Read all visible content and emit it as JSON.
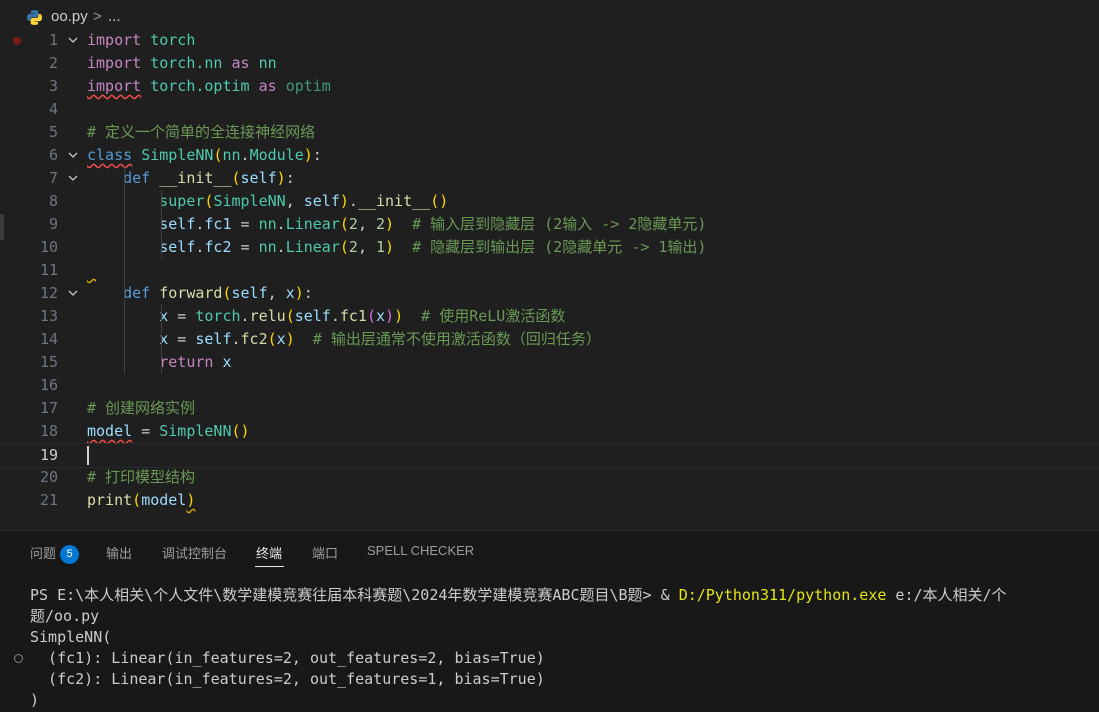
{
  "breadcrumb": {
    "file": "oo.py",
    "separator": ">",
    "more": "..."
  },
  "editor": {
    "lines": [
      {
        "n": "1",
        "tokens": [
          [
            "import",
            "kw"
          ],
          [
            " ",
            "pl"
          ],
          [
            "torch",
            "cls"
          ]
        ]
      },
      {
        "n": "2",
        "tokens": [
          [
            "import",
            "kw"
          ],
          [
            " ",
            "pl"
          ],
          [
            "torch.nn",
            "cls"
          ],
          [
            " ",
            "pl"
          ],
          [
            "as",
            "kw"
          ],
          [
            " ",
            "pl"
          ],
          [
            "nn",
            "cls"
          ]
        ]
      },
      {
        "n": "3",
        "tokens": [
          [
            "import",
            "kw sq-red"
          ],
          [
            " ",
            "pl"
          ],
          [
            "torch.optim",
            "cls"
          ],
          [
            " ",
            "pl"
          ],
          [
            "as",
            "kw"
          ],
          [
            " ",
            "pl"
          ],
          [
            "optim",
            "dim"
          ]
        ]
      },
      {
        "n": "4",
        "tokens": []
      },
      {
        "n": "5",
        "tokens": [
          [
            "# 定义一个简单的全连接神经网络",
            "cm"
          ]
        ]
      },
      {
        "n": "6",
        "tokens": [
          [
            "class",
            "kw2 sq-red"
          ],
          [
            " ",
            "pl"
          ],
          [
            "SimpleNN",
            "cls"
          ],
          [
            "(",
            "b1"
          ],
          [
            "nn",
            "cls"
          ],
          [
            ".",
            "pl"
          ],
          [
            "Module",
            "cls"
          ],
          [
            ")",
            "b1"
          ],
          [
            ":",
            "pl"
          ]
        ]
      },
      {
        "n": "7",
        "tokens": [
          [
            "    ",
            "pl"
          ],
          [
            "def",
            "kw2"
          ],
          [
            " ",
            "pl"
          ],
          [
            "__init__",
            "fn"
          ],
          [
            "(",
            "b1"
          ],
          [
            "self",
            "var"
          ],
          [
            ")",
            "b1"
          ],
          [
            ":",
            "pl"
          ]
        ]
      },
      {
        "n": "8",
        "tokens": [
          [
            "        ",
            "pl"
          ],
          [
            "super",
            "cls"
          ],
          [
            "(",
            "b1"
          ],
          [
            "SimpleNN",
            "cls"
          ],
          [
            ", ",
            "pl"
          ],
          [
            "self",
            "var"
          ],
          [
            ")",
            "b1"
          ],
          [
            ".",
            "pl"
          ],
          [
            "__init__",
            "fn"
          ],
          [
            "()",
            "b1"
          ]
        ]
      },
      {
        "n": "9",
        "tokens": [
          [
            "        ",
            "pl"
          ],
          [
            "self",
            "var"
          ],
          [
            ".",
            "pl"
          ],
          [
            "fc1",
            "var"
          ],
          [
            " = ",
            "pl"
          ],
          [
            "nn",
            "cls"
          ],
          [
            ".",
            "pl"
          ],
          [
            "Linear",
            "cls"
          ],
          [
            "(",
            "b1"
          ],
          [
            "2",
            "num"
          ],
          [
            ", ",
            "pl"
          ],
          [
            "2",
            "num"
          ],
          [
            ")",
            "b1"
          ],
          [
            "  ",
            "pl"
          ],
          [
            "# 输入层到隐藏层 (2输入 -> 2隐藏单元)",
            "cm"
          ]
        ]
      },
      {
        "n": "10",
        "tokens": [
          [
            "        ",
            "pl"
          ],
          [
            "self",
            "var"
          ],
          [
            ".",
            "pl"
          ],
          [
            "fc2",
            "var"
          ],
          [
            " = ",
            "pl"
          ],
          [
            "nn",
            "cls"
          ],
          [
            ".",
            "pl"
          ],
          [
            "Linear",
            "cls"
          ],
          [
            "(",
            "b1"
          ],
          [
            "2",
            "num"
          ],
          [
            ", ",
            "pl"
          ],
          [
            "1",
            "num"
          ],
          [
            ")",
            "b1"
          ],
          [
            "  ",
            "pl"
          ],
          [
            "# 隐藏层到输出层 (2隐藏单元 -> 1输出)",
            "cm"
          ]
        ]
      },
      {
        "n": "11",
        "tokens": []
      },
      {
        "n": "12",
        "tokens": [
          [
            "    ",
            "pl"
          ],
          [
            "def",
            "kw2"
          ],
          [
            " ",
            "pl"
          ],
          [
            "forward",
            "fn"
          ],
          [
            "(",
            "b1"
          ],
          [
            "self",
            "var"
          ],
          [
            ", ",
            "pl"
          ],
          [
            "x",
            "var"
          ],
          [
            ")",
            "b1"
          ],
          [
            ":",
            "pl"
          ]
        ]
      },
      {
        "n": "13",
        "tokens": [
          [
            "        ",
            "pl"
          ],
          [
            "x",
            "var"
          ],
          [
            " = ",
            "pl"
          ],
          [
            "torch",
            "cls"
          ],
          [
            ".",
            "pl"
          ],
          [
            "relu",
            "fn"
          ],
          [
            "(",
            "b1"
          ],
          [
            "self",
            "var"
          ],
          [
            ".",
            "pl"
          ],
          [
            "fc1",
            "fn"
          ],
          [
            "(",
            "b2"
          ],
          [
            "x",
            "var"
          ],
          [
            ")",
            "b2"
          ],
          [
            ")",
            "b1"
          ],
          [
            "  ",
            "pl"
          ],
          [
            "# 使用ReLU激活函数",
            "cm"
          ]
        ]
      },
      {
        "n": "14",
        "tokens": [
          [
            "        ",
            "pl"
          ],
          [
            "x",
            "var"
          ],
          [
            " = ",
            "pl"
          ],
          [
            "self",
            "var"
          ],
          [
            ".",
            "pl"
          ],
          [
            "fc2",
            "fn"
          ],
          [
            "(",
            "b1"
          ],
          [
            "x",
            "var"
          ],
          [
            ")",
            "b1"
          ],
          [
            "  ",
            "pl"
          ],
          [
            "# 输出层通常不使用激活函数（回归任务）",
            "cm"
          ]
        ]
      },
      {
        "n": "15",
        "tokens": [
          [
            "        ",
            "pl"
          ],
          [
            "return",
            "kw"
          ],
          [
            " ",
            "pl"
          ],
          [
            "x",
            "var"
          ]
        ]
      },
      {
        "n": "16",
        "tokens": []
      },
      {
        "n": "17",
        "tokens": [
          [
            "# 创建网络实例",
            "cm"
          ]
        ]
      },
      {
        "n": "18",
        "tokens": [
          [
            "model",
            "var sq-red"
          ],
          [
            " = ",
            "pl"
          ],
          [
            "SimpleNN",
            "cls"
          ],
          [
            "()",
            "b1"
          ]
        ]
      },
      {
        "n": "19",
        "tokens": []
      },
      {
        "n": "20",
        "tokens": [
          [
            "# 打印模型结构",
            "cm"
          ]
        ]
      },
      {
        "n": "21",
        "tokens": [
          [
            "print",
            "fn"
          ],
          [
            "(",
            "b1"
          ],
          [
            "model",
            "var"
          ],
          [
            ")",
            "b1 sq-yel"
          ]
        ]
      }
    ],
    "active_line": "19"
  },
  "panel": {
    "tabs": [
      {
        "label": "问题",
        "badge": "5"
      },
      {
        "label": "输出"
      },
      {
        "label": "调试控制台"
      },
      {
        "label": "终端"
      },
      {
        "label": "端口"
      },
      {
        "label": "SPELL CHECKER"
      }
    ],
    "active_tab": "终端",
    "terminal": {
      "prompt": "PS E:\\本人相关\\个人文件\\数学建模竞赛往届本科赛题\\2024年数学建模竞赛ABC题目\\B题> & ",
      "exe": "D:/Python311/python.exe",
      "cmd_rest": " e:/本人相关/个",
      "line2": "题/oo.py",
      "output": [
        "SimpleNN(",
        "  (fc1): Linear(in_features=2, out_features=2, bias=True)",
        "  (fc2): Linear(in_features=2, out_features=1, bias=True)",
        ")"
      ]
    }
  }
}
